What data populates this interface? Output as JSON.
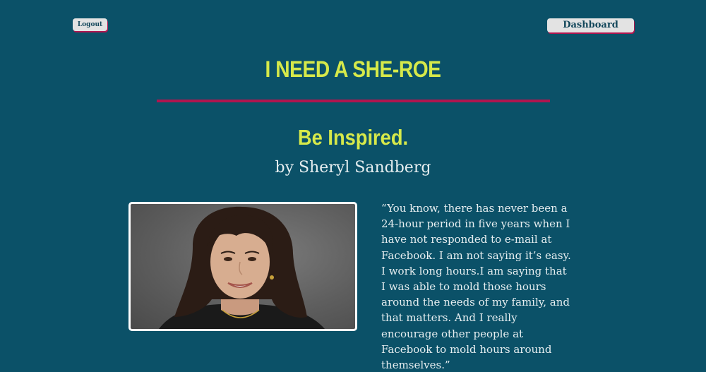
{
  "header": {
    "logout_label": "Logout",
    "dashboard_label": "Dashboard",
    "site_title": "I NEED A SHE-ROE"
  },
  "colors": {
    "background": "#0b5168",
    "accent_yellow": "#d6e94a",
    "accent_magenta": "#b0154f",
    "button_bg": "#e3e3e3"
  },
  "quote_section": {
    "heading": "Be Inspired.",
    "author": "by Sheryl Sandberg",
    "quote_text": "“You know, there has never been a 24-hour period in five years when I have not responded to e-mail at Facebook. I am not saying it’s easy. I work long hours.I am saying that I was able to mold those hours around the needs of my family, and that matters. And I really encourage other people at Facebook to mold hours around themselves.”"
  }
}
